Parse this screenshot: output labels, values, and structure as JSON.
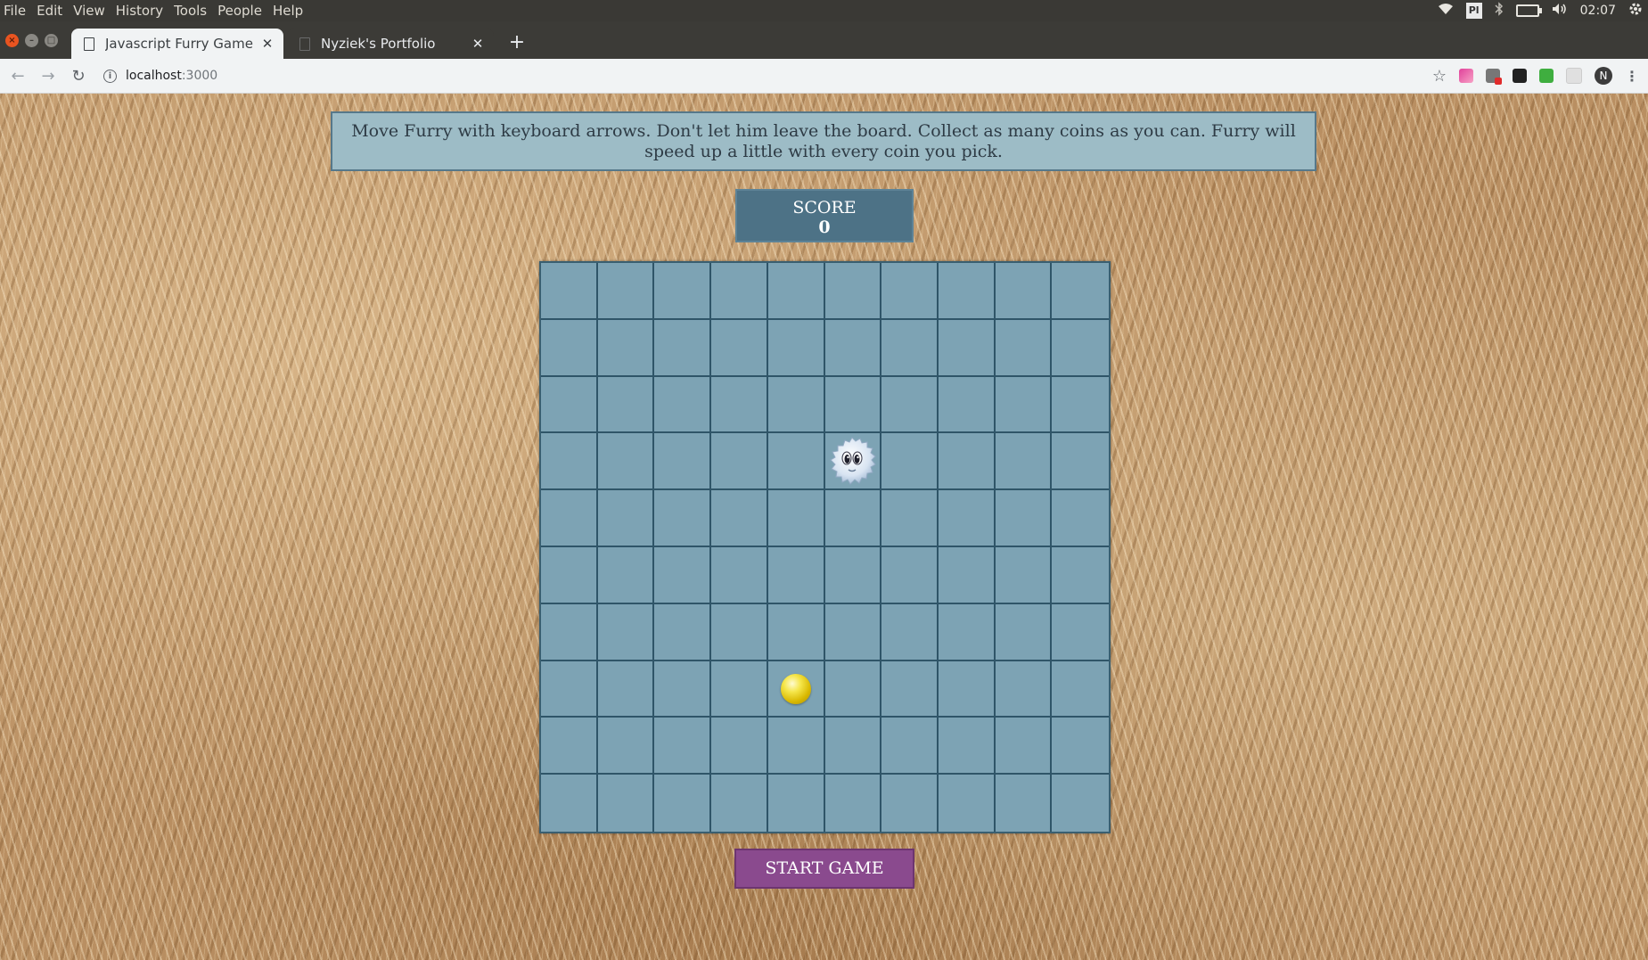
{
  "os_menu": [
    "File",
    "Edit",
    "View",
    "History",
    "Tools",
    "People",
    "Help"
  ],
  "tray": {
    "keyboard_layout": "Pl",
    "clock": "02:07"
  },
  "tabs": [
    {
      "title": "Javascript Furry Game",
      "active": true
    },
    {
      "title": "Nyziek's Portfolio",
      "active": false
    }
  ],
  "address": {
    "host": "localhost",
    "port": ":3000"
  },
  "profile": {
    "initial": "N"
  },
  "game": {
    "instructions": "Move Furry with keyboard arrows. Don't let him leave the board. Collect as many coins as you can. Furry will speed up a little with every coin you pick.",
    "score_label": "SCORE",
    "score_value": "0",
    "start_label": "START GAME",
    "board": {
      "columns": 10,
      "rows": 10
    },
    "furry_cell": {
      "col": 5,
      "row": 3
    },
    "coin_cell": {
      "col": 4,
      "row": 7
    }
  },
  "colors": {
    "board": "#7da3b4",
    "grid_line": "#2f5568",
    "score_bg": "#4d7286",
    "instructions_bg": "#9dbcc6",
    "start_bg": "#8a4a8e",
    "coin": "#f5e64a"
  },
  "icons": {
    "wifi": "wifi-icon",
    "bluetooth": "bluetooth-icon",
    "battery": "battery-icon",
    "volume": "volume-icon",
    "settings": "gear-icon",
    "back": "back-arrow-icon",
    "forward": "forward-arrow-icon",
    "reload": "reload-icon",
    "info": "info-icon",
    "bookmark": "star-icon",
    "menu": "kebab-menu-icon"
  }
}
